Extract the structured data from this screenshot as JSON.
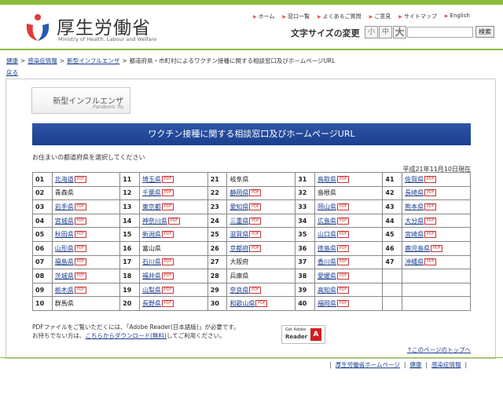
{
  "header": {
    "logo_title": "厚生労働省",
    "logo_subtitle": "Ministry of Health, Labour and Welfare",
    "nav": [
      "ホーム",
      "窓口一覧",
      "よくあるご質問",
      "ご意見",
      "サイトマップ",
      "English"
    ],
    "font_size_label": "文字サイズの変更",
    "font_size_buttons": [
      "小",
      "中",
      "大"
    ],
    "search_button": "検索"
  },
  "breadcrumb": [
    "健康",
    "感染症情報",
    "新型インフルエンザ",
    "都道府県・市町村によるワクチン接種に関する相談窓口及びホームページURL"
  ],
  "back_link": "戻る",
  "section_badge": {
    "jp": "新型インフルエンザ",
    "en": "Pandemic flu"
  },
  "banner_title": "ワクチン接種に関する相談窓口及びホームページURL",
  "select_prompt": "お住まいの都道府県を選択してください",
  "date": "平成21年11月10日現在",
  "pdf_icon": "PDF",
  "prefectures": [
    {
      "n": "01",
      "name": "北海道",
      "link": true
    },
    {
      "n": "02",
      "name": "青森県",
      "link": false
    },
    {
      "n": "03",
      "name": "岩手県",
      "link": true
    },
    {
      "n": "04",
      "name": "宮城県",
      "link": true
    },
    {
      "n": "05",
      "name": "秋田県",
      "link": true
    },
    {
      "n": "06",
      "name": "山形県",
      "link": true
    },
    {
      "n": "07",
      "name": "福島県",
      "link": true
    },
    {
      "n": "08",
      "name": "茨城県",
      "link": true
    },
    {
      "n": "09",
      "name": "栃木県",
      "link": true
    },
    {
      "n": "10",
      "name": "群馬県",
      "link": false
    },
    {
      "n": "11",
      "name": "埼玉県",
      "link": true
    },
    {
      "n": "12",
      "name": "千葉県",
      "link": true
    },
    {
      "n": "13",
      "name": "東京都",
      "link": true
    },
    {
      "n": "14",
      "name": "神奈川県",
      "link": true
    },
    {
      "n": "15",
      "name": "新潟県",
      "link": true
    },
    {
      "n": "16",
      "name": "富山県",
      "link": false
    },
    {
      "n": "17",
      "name": "石川県",
      "link": true
    },
    {
      "n": "18",
      "name": "福井県",
      "link": true
    },
    {
      "n": "19",
      "name": "山梨県",
      "link": true
    },
    {
      "n": "20",
      "name": "長野県",
      "link": true
    },
    {
      "n": "21",
      "name": "岐阜県",
      "link": false
    },
    {
      "n": "22",
      "name": "静岡県",
      "link": true
    },
    {
      "n": "23",
      "name": "愛知県",
      "link": true
    },
    {
      "n": "24",
      "name": "三重県",
      "link": true
    },
    {
      "n": "25",
      "name": "滋賀県",
      "link": true
    },
    {
      "n": "26",
      "name": "京都府",
      "link": true
    },
    {
      "n": "27",
      "name": "大阪府",
      "link": false
    },
    {
      "n": "28",
      "name": "兵庫県",
      "link": false
    },
    {
      "n": "29",
      "name": "奈良県",
      "link": true
    },
    {
      "n": "30",
      "name": "和歌山県",
      "link": true
    },
    {
      "n": "31",
      "name": "鳥取県",
      "link": true
    },
    {
      "n": "32",
      "name": "島根県",
      "link": false
    },
    {
      "n": "33",
      "name": "岡山県",
      "link": true
    },
    {
      "n": "34",
      "name": "広島県",
      "link": true
    },
    {
      "n": "35",
      "name": "山口県",
      "link": true
    },
    {
      "n": "36",
      "name": "徳島県",
      "link": true
    },
    {
      "n": "37",
      "name": "香川県",
      "link": true
    },
    {
      "n": "38",
      "name": "愛媛県",
      "link": true
    },
    {
      "n": "39",
      "name": "高知県",
      "link": true
    },
    {
      "n": "40",
      "name": "福岡県",
      "link": true
    },
    {
      "n": "41",
      "name": "佐賀県",
      "link": true
    },
    {
      "n": "42",
      "name": "長崎県",
      "link": true
    },
    {
      "n": "43",
      "name": "熊本県",
      "link": true
    },
    {
      "n": "44",
      "name": "大分県",
      "link": true
    },
    {
      "n": "45",
      "name": "宮崎県",
      "link": true
    },
    {
      "n": "46",
      "name": "鹿児島県",
      "link": true
    },
    {
      "n": "47",
      "name": "沖縄県",
      "link": true
    },
    {
      "n": "",
      "name": "",
      "link": false
    },
    {
      "n": "",
      "name": "",
      "link": false
    },
    {
      "n": "",
      "name": "",
      "link": false
    }
  ],
  "pdf_note": {
    "line1": "PDFファイルをご覧いただくには、「Adobe Reader(日本語版)」が必要です。",
    "line2_pre": "お持ちでない方は、",
    "line2_link": "こちらからダウンロード(無料)",
    "line2_post": "してご利用ください。"
  },
  "adobe_badge": {
    "line1": "Get Adobe",
    "line2": "Reader"
  },
  "to_top": "↑このページのトップへ",
  "footer_nav": [
    "厚生労働省ホームページ",
    "健康",
    "感染症情報"
  ],
  "colors": {
    "accent_green": "#8dbb3a",
    "banner_blue": "#1b3f8e",
    "link": "#1a3d8f"
  }
}
